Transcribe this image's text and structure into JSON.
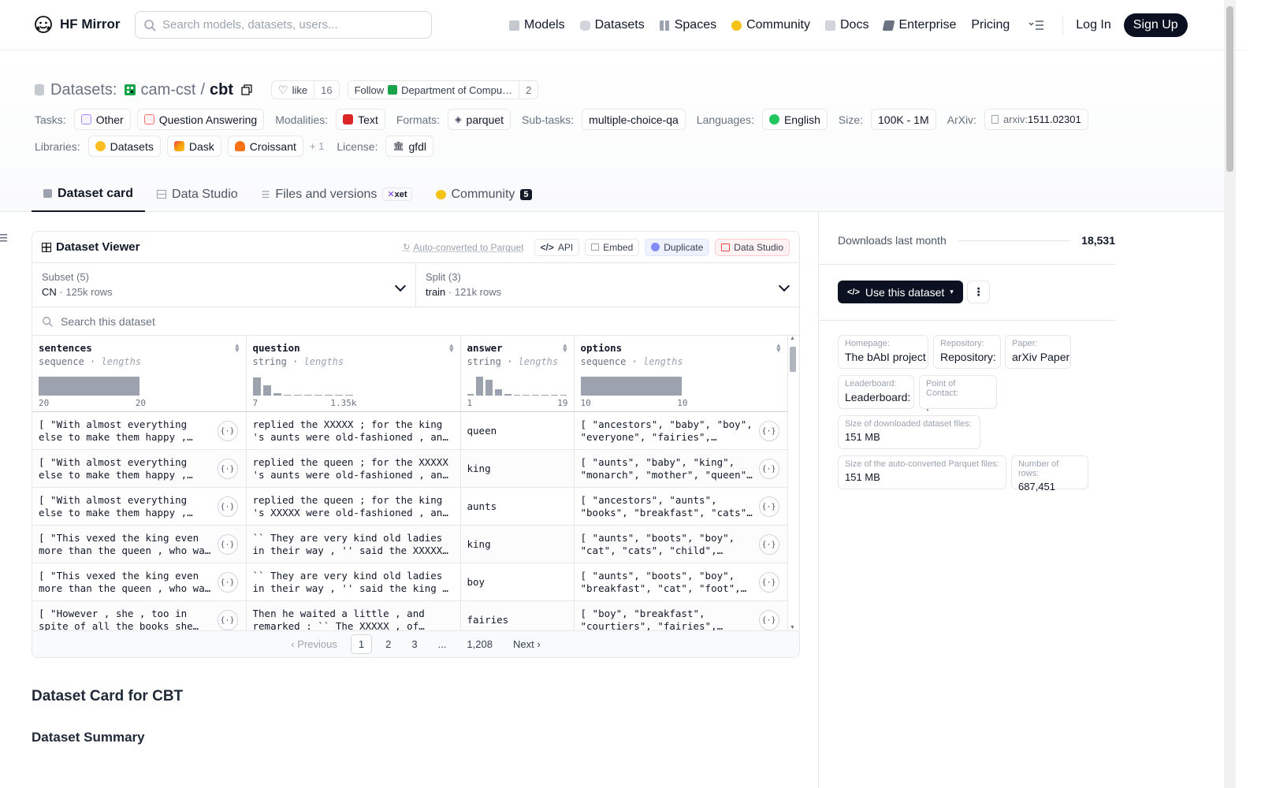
{
  "nav": {
    "brand": "HF Mirror",
    "search_placeholder": "Search models, datasets, users...",
    "links": [
      {
        "label": "Models",
        "icon": "models-icon",
        "color": "#9ca3af"
      },
      {
        "label": "Datasets",
        "icon": "datasets-icon",
        "color": "#c5c9d0"
      },
      {
        "label": "Spaces",
        "icon": "spaces-icon",
        "color": "#9ca3af"
      },
      {
        "label": "Community",
        "icon": "community-icon",
        "color": "#f5c218"
      },
      {
        "label": "Docs",
        "icon": "docs-icon",
        "color": "#9ca3af"
      },
      {
        "label": "Enterprise",
        "icon": "enterprise-icon",
        "color": "#6b7280"
      },
      {
        "label": "Pricing",
        "icon": "",
        "color": ""
      }
    ],
    "login": "Log In",
    "signup": "Sign Up"
  },
  "header": {
    "prefix": "Datasets:",
    "owner": "cam-cst",
    "separator": "/",
    "name": "cbt",
    "like_label": "like",
    "like_count": "16",
    "follow_label": "Follow",
    "follow_org": "Department of Compu…",
    "follow_count": "2"
  },
  "meta": {
    "tasks_label": "Tasks:",
    "tasks": [
      "Other",
      "Question Answering"
    ],
    "modalities_label": "Modalities:",
    "modalities": [
      "Text"
    ],
    "formats_label": "Formats:",
    "formats": [
      "parquet"
    ],
    "subtasks_label": "Sub-tasks:",
    "subtasks": [
      "multiple-choice-qa"
    ],
    "languages_label": "Languages:",
    "languages": [
      "English"
    ],
    "size_label": "Size:",
    "size": "100K - 1M",
    "arxiv_label": "ArXiv:",
    "arxiv_prefix": "arxiv:",
    "arxiv_id": "1511.02301",
    "libraries_label": "Libraries:",
    "libraries": [
      "Datasets",
      "Dask",
      "Croissant"
    ],
    "libraries_more": "+ 1",
    "license_label": "License:",
    "license": "gfdl"
  },
  "tabs": [
    {
      "label": "Dataset card",
      "active": true
    },
    {
      "label": "Data Studio"
    },
    {
      "label": "Files and versions",
      "badge": "xet"
    },
    {
      "label": "Community",
      "count": "5"
    }
  ],
  "viewer": {
    "title": "Dataset Viewer",
    "auto_converted": "Auto-converted to Parquet",
    "api": "API",
    "embed": "Embed",
    "duplicate": "Duplicate",
    "data_studio": "Data Studio",
    "subset_label": "Subset (5)",
    "subset_value": "CN",
    "subset_rows": "125k rows",
    "split_label": "Split (3)",
    "split_value": "train",
    "split_rows": "121k rows",
    "search_placeholder": "Search this dataset",
    "columns": [
      {
        "name": "sentences",
        "type": "sequence",
        "stat": "lengths",
        "min": "20",
        "max": "20",
        "hist": [
          1
        ]
      },
      {
        "name": "question",
        "type": "string",
        "stat": "lengths",
        "min": "7",
        "max": "1.35k",
        "hist": [
          0.95,
          0.55,
          0.12,
          0.05,
          0.05,
          0.05,
          0.05,
          0.05,
          0,
          0.05
        ]
      },
      {
        "name": "answer",
        "type": "string",
        "stat": "lengths",
        "min": "1",
        "max": "19",
        "hist": [
          0.08,
          1,
          0.85,
          0.35,
          0.08,
          0.05,
          0.05,
          0.05,
          0.05,
          0.05,
          0.05
        ]
      },
      {
        "name": "options",
        "type": "sequence",
        "stat": "lengths",
        "min": "10",
        "max": "10",
        "hist": [
          1
        ]
      }
    ],
    "rows": [
      {
        "sentences": "[ \"With almost everything else to make them happy , they wanted one thing : they had no children .\"",
        "question": "replied the XXXXX ; for the king 's aunts were old-fashioned , and didn't",
        "answer": "queen",
        "options": "[ \"ancestors\", \"baby\", \"boy\", \"everyone\", \"fairies\", \"mother\" ]"
      },
      {
        "sentences": "[ \"With almost everything else to make them happy , they wanted one thing : they had no children .\"",
        "question": "replied the queen ; for the XXXXX 's aunts were old-fashioned , and didn't",
        "answer": "king",
        "options": "[ \"aunts\", \"baby\", \"king\", \"monarch\", \"mother\", \"queen\" ]"
      },
      {
        "sentences": "[ \"With almost everything else to make them happy , they wanted one thing : they had no children .\"",
        "question": "replied the queen ; for the king 's XXXXX were old-fashioned , and didn't",
        "answer": "aunts",
        "options": "[ \"ancestors\", \"aunts\", \"books\", \"breakfast\", \"cats\", \"children\" ]"
      },
      {
        "sentences": "[ \"This vexed the king even more than the queen , who was very clever and learned .\"",
        "question": "`` They are very kind old ladies in their way , '' said the XXXXX ; `` but",
        "answer": "king",
        "options": "[ \"aunts\", \"boots\", \"boy\", \"cat\", \"cats\", \"child\", \"children\" ]"
      },
      {
        "sentences": "[ \"This vexed the king even more than the queen , who was very clever and learned .\"",
        "question": "`` They are very kind old ladies in their way , '' said the king ; `` and",
        "answer": "boy",
        "options": "[ \"aunts\", \"boots\", \"boy\", \"breakfast\", \"cat\", \"foot\", \"fairies\" ]"
      },
      {
        "sentences": "[ \"However , she , too in spite of all the books she read and pictures she",
        "question": "Then he waited a little , and remarked : `` The XXXXX , of course , will",
        "answer": "fairies",
        "options": "[ \"boy\", \"breakfast\", \"courtiers\", \"fairies\", \"lady\", \"queen\" ]"
      }
    ],
    "pager": {
      "prev": "Previous",
      "pages": [
        "1",
        "2",
        "3",
        "...",
        "1,208"
      ],
      "next": "Next"
    }
  },
  "card": {
    "heading": "Dataset Card for CBT",
    "summary_heading": "Dataset Summary"
  },
  "sidebar": {
    "downloads_label": "Downloads last month",
    "downloads_value": "18,531",
    "use_dataset": "Use this dataset",
    "homepage_label": "Homepage:",
    "homepage_value": "The bAbI project",
    "repository_label": "Repository:",
    "repository_value": "Repository:",
    "paper_label": "Paper:",
    "paper_value": "arXiv Paper",
    "leaderboard_label": "Leaderboard:",
    "leaderboard_value": "Leaderboard:",
    "contact_label": "Point of Contact:",
    "contact_value": ".",
    "downloaded_size_label": "Size of downloaded dataset files:",
    "downloaded_size_value": "151 MB",
    "parquet_size_label": "Size of the auto-converted Parquet files:",
    "parquet_size_value": "151 MB",
    "num_rows_label": "Number of rows:",
    "num_rows_value": "687,451"
  }
}
